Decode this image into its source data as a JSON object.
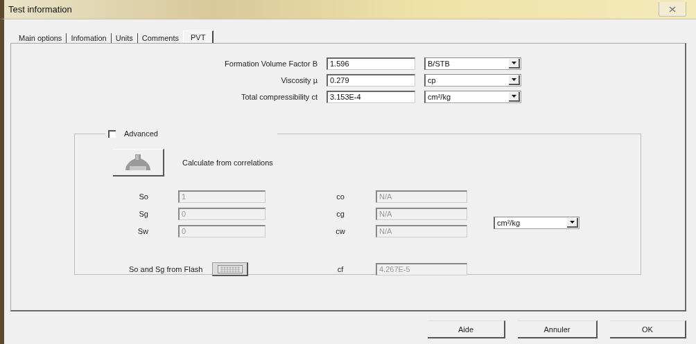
{
  "window": {
    "title": "Test information"
  },
  "tabs": [
    {
      "label": "Main options",
      "selected": false
    },
    {
      "label": "Infomation",
      "selected": false
    },
    {
      "label": "Units",
      "selected": false
    },
    {
      "label": "Comments",
      "selected": false
    },
    {
      "label": "PVT",
      "selected": true
    }
  ],
  "main_fields": [
    {
      "label": "Formation Volume Factor B",
      "value": "1.596",
      "unit": "B/STB"
    },
    {
      "label": "Viscosity µ",
      "value": "0.279",
      "unit": "cp"
    },
    {
      "label": "Total compressibility ct",
      "value": "3.153E-4",
      "unit": "cm²/kg"
    }
  ],
  "advanced": {
    "label": "Advanced",
    "checked": false,
    "calculate_label": "Calculate from correlations",
    "saturations": [
      {
        "label": "So",
        "value": "1"
      },
      {
        "label": "Sg",
        "value": "0"
      },
      {
        "label": "Sw",
        "value": "0"
      }
    ],
    "compressibilities": [
      {
        "label": "co",
        "value": "N/A"
      },
      {
        "label": "cg",
        "value": "N/A"
      },
      {
        "label": "cw",
        "value": "N/A"
      }
    ],
    "flash_label": "So and Sg from Flash",
    "cf": {
      "label": "cf",
      "value": "4.267E-5"
    },
    "unit": "cm²/kg"
  },
  "buttons": [
    "Aide",
    "Annuler",
    "OK"
  ]
}
